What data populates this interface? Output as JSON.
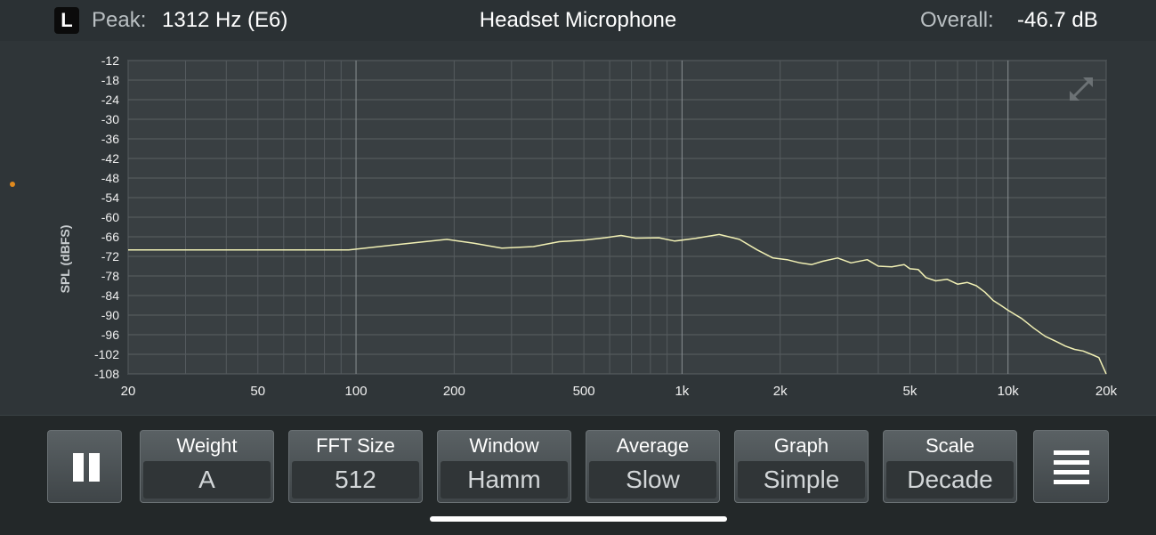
{
  "header": {
    "channel": "L",
    "peak_label": "Peak:",
    "peak_value": "1312 Hz (E6)",
    "title": "Headset Microphone",
    "overall_label": "Overall:",
    "overall_value": "-46.7 dB"
  },
  "chart": {
    "ylabel": "SPL (dBFS)",
    "y_ticks": [
      "-12",
      "-18",
      "-24",
      "-30",
      "-36",
      "-42",
      "-48",
      "-54",
      "-60",
      "-66",
      "-72",
      "-78",
      "-84",
      "-90",
      "-96",
      "-102",
      "-108"
    ],
    "x_ticks": [
      "20",
      "50",
      "100",
      "200",
      "500",
      "1k",
      "2k",
      "5k",
      "10k",
      "20k"
    ],
    "expand_icon": "expand-arrows-icon"
  },
  "chart_data": {
    "type": "line",
    "xlabel": "",
    "ylabel": "SPL (dBFS)",
    "xscale": "log",
    "xlim": [
      20,
      20000
    ],
    "ylim": [
      -108,
      -12
    ],
    "grid": true,
    "line_color": "#f1f0b4",
    "series": [
      {
        "x": [
          20,
          30,
          50,
          70,
          95,
          100,
          130,
          190,
          230,
          280,
          350,
          420,
          500,
          580,
          650,
          720,
          850,
          950,
          1100,
          1300,
          1500,
          1700,
          1900,
          2100,
          2300,
          2500,
          2700,
          3000,
          3300,
          3700,
          4000,
          4400,
          4800,
          5000,
          5300,
          5600,
          6000,
          6500,
          7000,
          7500,
          8000,
          8500,
          9000,
          9500,
          10000,
          11000,
          12000,
          13000,
          14000,
          15000,
          16000,
          17000,
          18000,
          19000,
          20000
        ],
        "y": [
          -70,
          -70,
          -70,
          -70,
          -70,
          -69.8,
          -68.5,
          -66.8,
          -68,
          -69.5,
          -69,
          -67.5,
          -67,
          -66.3,
          -65.6,
          -66.4,
          -66.3,
          -67.3,
          -66.5,
          -65.3,
          -66.8,
          -70,
          -72.5,
          -73,
          -74,
          -74.5,
          -73.5,
          -72.5,
          -74,
          -73,
          -75,
          -75.2,
          -74.5,
          -75.8,
          -76,
          -78.5,
          -79.5,
          -79,
          -80.5,
          -80,
          -81,
          -83,
          -85.5,
          -87,
          -88.5,
          -91,
          -94,
          -96.5,
          -98,
          -99.5,
          -100.5,
          -101,
          -102,
          -103,
          -108
        ]
      }
    ]
  },
  "controls": {
    "pause": {
      "icon": "pause-icon"
    },
    "weight": {
      "title": "Weight",
      "value": "A"
    },
    "fft": {
      "title": "FFT Size",
      "value": "512"
    },
    "window": {
      "title": "Window",
      "value": "Hamm"
    },
    "average": {
      "title": "Average",
      "value": "Slow"
    },
    "graph": {
      "title": "Graph",
      "value": "Simple"
    },
    "scale": {
      "title": "Scale",
      "value": "Decade"
    },
    "menu": {
      "icon": "menu-icon"
    }
  }
}
